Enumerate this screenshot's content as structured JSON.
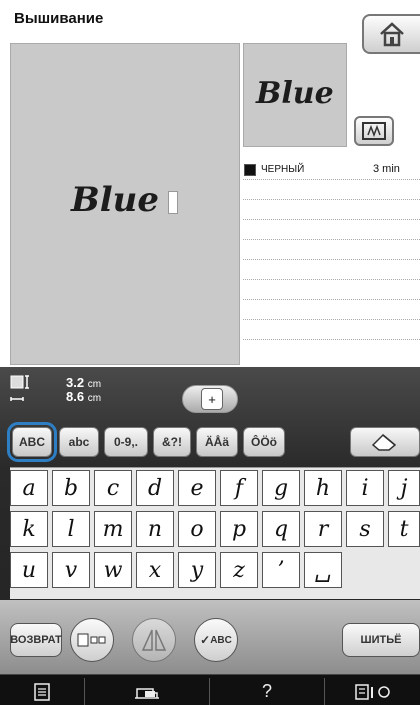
{
  "header": {
    "title": "Вышивание",
    "home_icon": "home-icon"
  },
  "canvas": {
    "text": "Blue"
  },
  "preview": {
    "text": "Blue",
    "frame_icon": "embroidery-frame-icon"
  },
  "colors": {
    "items": [
      {
        "name": "ЧЕРНЫЙ",
        "time": "3 min",
        "swatch": "#111111"
      }
    ],
    "empty_rows": 8
  },
  "size": {
    "height": "3.2",
    "width": "8.6",
    "unit": "cm"
  },
  "font_tabs": [
    {
      "label": "ABC",
      "selected": true
    },
    {
      "label": "abc"
    },
    {
      "label": "0-9,."
    },
    {
      "label": "&?!"
    },
    {
      "label": "ÄÅä"
    },
    {
      "label": "ÔÖö"
    }
  ],
  "eraser_icon": "eraser-icon",
  "keys": {
    "row1": [
      "a",
      "b",
      "c",
      "d",
      "e",
      "f",
      "g",
      "h",
      "i",
      "j"
    ],
    "row2": [
      "k",
      "l",
      "m",
      "n",
      "o",
      "p",
      "q",
      "r",
      "s",
      "t"
    ],
    "row3": [
      "u",
      "v",
      "w",
      "x",
      "y",
      "z",
      "’",
      "␣"
    ]
  },
  "bottom": {
    "back_label": "ВОЗВРАТ",
    "check_label": "ABC",
    "sew_label": "ШИТЬЁ"
  },
  "footer": {
    "help": "?"
  },
  "accent": "#2e7ec4"
}
